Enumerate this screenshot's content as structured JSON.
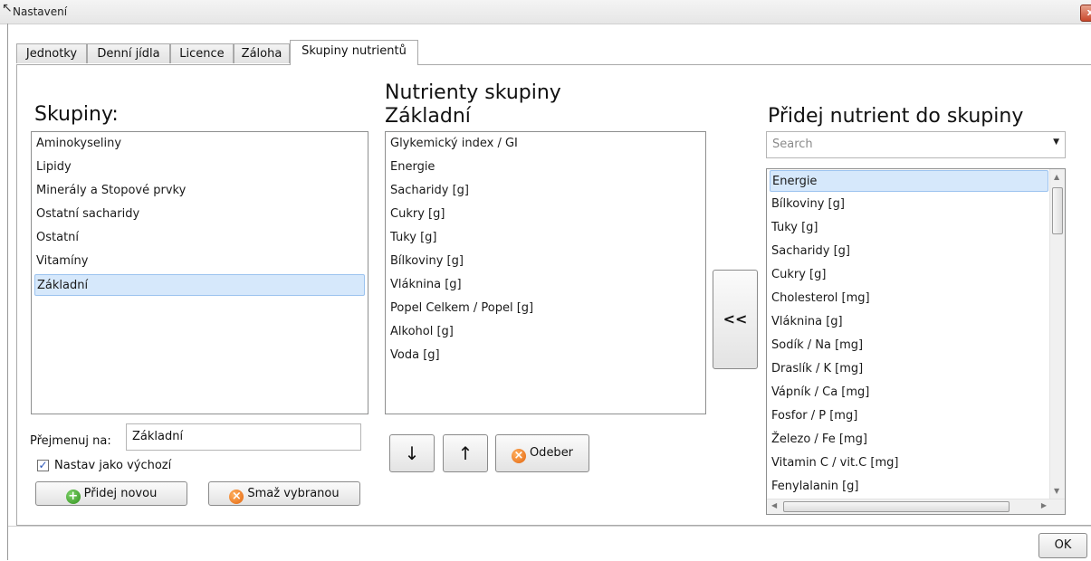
{
  "window": {
    "title": "Nastavení",
    "close_label": "x"
  },
  "tabs": [
    {
      "label": "Jednotky"
    },
    {
      "label": "Denní jídla"
    },
    {
      "label": "Licence"
    },
    {
      "label": "Záloha"
    },
    {
      "label": "Skupiny nutrientů",
      "active": true
    }
  ],
  "groups": {
    "heading": "Skupiny:",
    "items": [
      "Aminokyseliny",
      "Lipidy",
      "Minerály a Stopové prvky",
      "Ostatní sacharidy",
      "Ostatní",
      "Vitamíny",
      "Základní"
    ],
    "selected": "Základní",
    "rename_label": "Přejmenuj na:",
    "rename_value": "Základní",
    "default_checkbox_label": "Nastav jako výchozí",
    "default_checked": true,
    "add_button": "Přidej novou",
    "delete_button": "Smaž vybranou"
  },
  "group_nutrients": {
    "heading_line1": "Nutrienty skupiny",
    "heading_line2": "Základní",
    "items": [
      "Glykemický index / GI",
      "Energie",
      "Sacharidy  [g]",
      "Cukry  [g]",
      "Tuky  [g]",
      "Bílkoviny  [g]",
      "Vláknina  [g]",
      "Popel Celkem / Popel  [g]",
      "Alkohol  [g]",
      "Voda  [g]"
    ],
    "down_button": "↓",
    "up_button": "↑",
    "remove_button": "Odeber"
  },
  "transfer_button": "<<",
  "add_nutrient": {
    "heading": "Přidej nutrient do skupiny",
    "search_placeholder": "Search",
    "items": [
      "Energie",
      "Bílkoviny  [g]",
      "Tuky  [g]",
      "Sacharidy  [g]",
      "Cukry  [g]",
      "Cholesterol  [mg]",
      "Vláknina  [g]",
      "Sodík / Na  [mg]",
      "Draslík / K  [mg]",
      "Vápník / Ca  [mg]",
      "Fosfor / P  [mg]",
      "Železo / Fe  [mg]",
      "Vitamin C / vit.C  [mg]",
      "Fenylalanin  [g]"
    ],
    "selected": "Energie"
  },
  "ok_button": "OK"
}
